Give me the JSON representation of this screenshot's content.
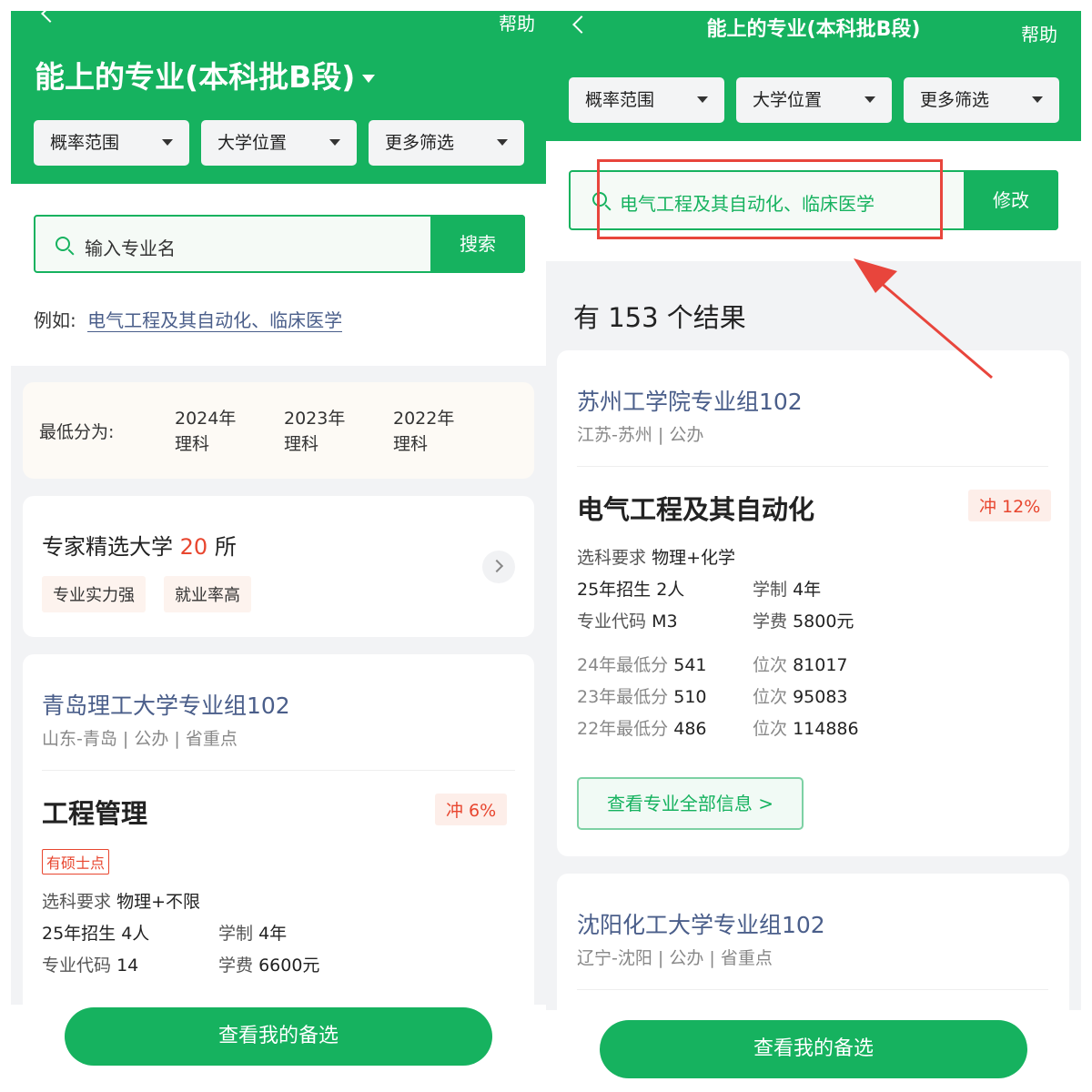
{
  "left": {
    "help": "帮助",
    "title": "能上的专业(本科批B段)",
    "filters": [
      "概率范围",
      "大学位置",
      "更多筛选"
    ],
    "search_placeholder": "输入专业名",
    "search_button": "搜索",
    "example_label": "例如:",
    "example_link": "电气工程及其自动化、临床医学",
    "min_score_label": "最低分为:",
    "years": [
      {
        "year": "2024年",
        "subject": "理科"
      },
      {
        "year": "2023年",
        "subject": "理科"
      },
      {
        "year": "2022年",
        "subject": "理科"
      }
    ],
    "expert": {
      "prefix": "专家精选大学",
      "count": "20",
      "suffix": "所",
      "tags": [
        "专业实力强",
        "就业率高"
      ]
    },
    "school": {
      "name": "青岛理工大学专业组102",
      "meta": "山东-青岛 | 公办 | 省重点",
      "major": "工程管理",
      "rush": "冲 6%",
      "master_tag": "有硕士点",
      "subject_req_k": "选科要求",
      "subject_req_v": "物理+不限",
      "enroll": "25年招生 4人",
      "duration_k": "学制",
      "duration_v": "4年",
      "code_k": "专业代码",
      "code_v": "14",
      "fee_k": "学费",
      "fee_v": "6600元"
    },
    "bottom_button": "查看我的备选"
  },
  "right": {
    "help": "帮助",
    "title": "能上的专业(本科批B段)",
    "filters": [
      "概率范围",
      "大学位置",
      "更多筛选"
    ],
    "search_value": "电气工程及其自动化、临床医学",
    "modify_button": "修改",
    "results": "有 153 个结果",
    "school1": {
      "name": "苏州工学院专业组102",
      "meta": "江苏-苏州 | 公办",
      "major": "电气工程及其自动化",
      "rush": "冲 12%",
      "subject_req_k": "选科要求",
      "subject_req_v": "物理+化学",
      "enroll": "25年招生 2人",
      "duration_k": "学制",
      "duration_v": "4年",
      "code_k": "专业代码",
      "code_v": "M3",
      "fee_k": "学费",
      "fee_v": "5800元",
      "scores": [
        {
          "k": "24年最低分",
          "v": "541",
          "rk": "位次",
          "rv": "81017"
        },
        {
          "k": "23年最低分",
          "v": "510",
          "rk": "位次",
          "rv": "95083"
        },
        {
          "k": "22年最低分",
          "v": "486",
          "rk": "位次",
          "rv": "114886"
        }
      ],
      "view_all": "查看专业全部信息 >"
    },
    "school2": {
      "name": "沈阳化工大学专业组102",
      "meta": "辽宁-沈阳 | 公办 | 省重点"
    },
    "bottom_button": "查看我的备选"
  },
  "colors": {
    "brand_green": "#16b25f",
    "annotation_red": "#e8453c",
    "rush_red": "#e8462f",
    "school_blue": "#4a5e8a"
  }
}
